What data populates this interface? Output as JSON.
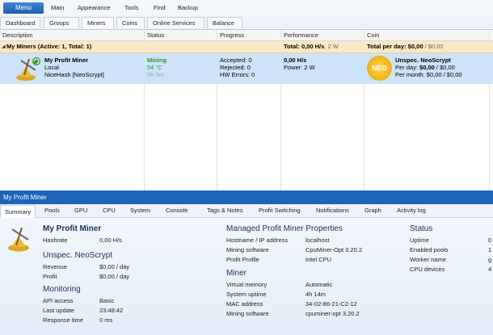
{
  "ribbon": {
    "menu_label": "Menu",
    "items": [
      "Main",
      "Appearance",
      "Tools",
      "Find",
      "Backup"
    ]
  },
  "subtabs": [
    "Dashboard",
    "Groups",
    "Miners",
    "Coins",
    "Online Services",
    "Balance"
  ],
  "grid": {
    "headers": [
      "Description",
      "Status",
      "Progress",
      "Performance",
      "Coin"
    ],
    "group": {
      "label": "My Miners (Active: 1, Total: 1)",
      "total": "Total: 0,00 H/s",
      "total_power": ", 2 W",
      "per_day_label": "Total per day:",
      "per_day_value": "$0,00",
      "per_day_alt": " / $0,00"
    },
    "miner": {
      "name": "My Profit Miner",
      "location": "Local",
      "pool": "NiceHash [NeoScrypt]",
      "status": "Mining",
      "temp": "54 °C",
      "uptime": "0h 0m",
      "accepted": "Accepted: 0",
      "rejected": "Rejected: 0",
      "hw_errors": "HW Errors: 0",
      "hashrate": "0,00 H/s",
      "power": "Power: 2 W",
      "coin_badge": "NEO",
      "coin_name": "Unspec. NeoScrypt",
      "per_day_label": "Per day:",
      "per_day_value": "$0,00",
      "per_day_alt": " / $0,00",
      "per_month": "Per month: $0,00 / $0,00"
    }
  },
  "panel": {
    "title": "My Profit Miner",
    "tabs": [
      "Summary",
      "Pools",
      "GPU",
      "CPU",
      "System",
      "Console",
      "Tags & Notes",
      "Profit Switching",
      "Notifications",
      "Graph",
      "Activity log"
    ]
  },
  "summary": {
    "miner_title": "My Profit Miner",
    "hashrate_label": "Hashrate",
    "hashrate_value": "0,00 H/s",
    "coin_title": "Unspec. NeoScrypt",
    "revenue_label": "Revenue",
    "revenue_value": "$0,00 / day",
    "profit_label": "Profit",
    "profit_value": "$0,00 / day",
    "monitoring_title": "Monitoring",
    "api_label": "API access",
    "api_value": "Basic",
    "update_label": "Last update",
    "update_value": "23:48:42",
    "response_label": "Response time",
    "response_value": "0 ms"
  },
  "props": {
    "title": "Managed Profit Miner Properties",
    "host_label": "Hostname / IP address",
    "host_value": "localhost",
    "software_label": "Mining software",
    "software_value": "CpuMiner-Opt 3.20.2",
    "profile_label": "Profit Profile",
    "profile_value": "Intel CPU",
    "miner_title": "Miner",
    "vmem_label": "Virtual memory",
    "vmem_value": "Automatic",
    "sysup_label": "System uptime",
    "sysup_value": "4h 14m",
    "mac_label": "MAC address",
    "mac_value": "34-02-86-21-C2-12",
    "sw2_label": "Mining software",
    "sw2_value": "cpuminer-opt 3.20.2"
  },
  "status": {
    "title": "Status",
    "uptime_label": "Uptime",
    "uptime_value": "0",
    "pools_label": "Enabled pools",
    "pools_value": "1",
    "worker_label": "Worker name",
    "worker_value": "g",
    "cpu_label": "CPU devices",
    "cpu_value": "4"
  },
  "colors": {
    "accent": "#1e64b8",
    "mining_green": "#2a9a2a",
    "group_bg": "#fbe8c4",
    "selected_row": "#cde3f7",
    "coin_badge": "#f2b500"
  }
}
